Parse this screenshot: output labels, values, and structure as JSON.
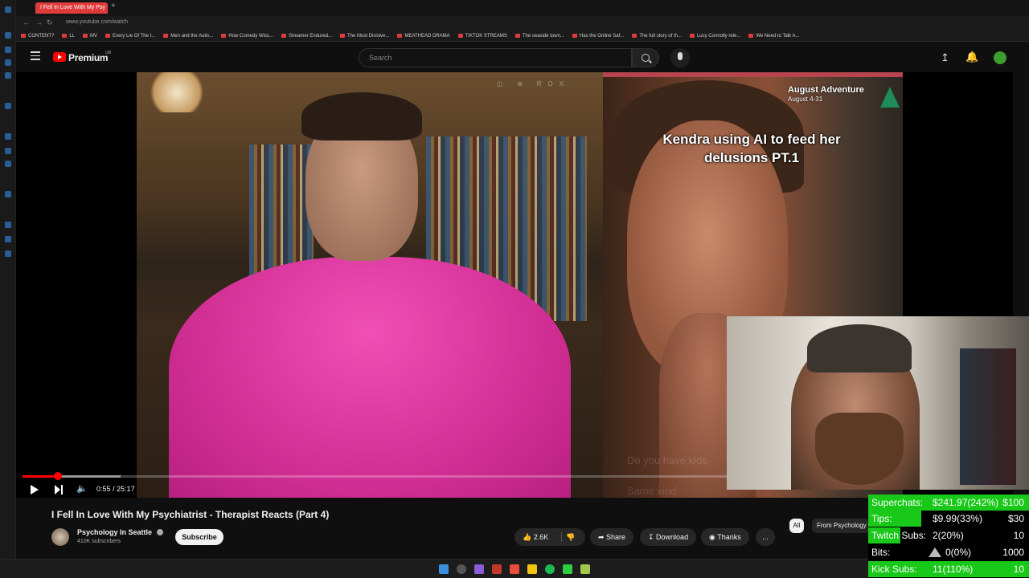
{
  "browser": {
    "active_tab": "I Fell In Love With My Psy",
    "url": "www.youtube.com/watch",
    "bookmarks": [
      "CONTENT?",
      "LL",
      "MV",
      "Every Lie Of The I...",
      "Men and the Autis...",
      "How Comedy Wiss...",
      "Streamer Endured...",
      "The Most Divisive...",
      "MEATHEAD DRAMA",
      "TIKTOK STREAMS",
      "The seaside town...",
      "Has the Online Saf...",
      "The full story of th...",
      "Lucy Connolly rele...",
      "We Need to Talk A..."
    ]
  },
  "youtube": {
    "brand": "Premium",
    "region": "GB",
    "search_placeholder": "Search"
  },
  "video": {
    "tiktok_caption": "Kendra using AI to feed her delusions PT.1",
    "tiktok_tag_title": "August Adventure",
    "tiktok_tag_dates": "August 4-31",
    "faded_sub_1": "Do you have kids",
    "faded_sub_2": "Same kind",
    "overlay_icons_label": "ROX",
    "time_current": "0:55",
    "time_total": "25:17",
    "progress_fraction": 0.036,
    "buffer_fraction": 0.1
  },
  "meta": {
    "title": "I Fell In Love With My Psychiatrist - Therapist Reacts (Part 4)",
    "channel": "Psychology In Seattle",
    "subscribers": "410K subscribers",
    "subscribe_label": "Subscribe",
    "likes": "2.6K",
    "share_label": "Share",
    "download_label": "Download",
    "thanks_label": "Thanks",
    "more_label": "...",
    "chip_all": "All",
    "chip_from": "From Psychology"
  },
  "stats": [
    {
      "key": "Superchats:",
      "value": "$241.97(242%)",
      "goal": "$100",
      "fill": 1.0,
      "color": "#19c919"
    },
    {
      "key": "Tips:",
      "value": "$9.99(33%)",
      "goal": "$30",
      "fill": 0.33,
      "color": "#19c919"
    },
    {
      "key": "Twitch Subs:",
      "value": "2(20%)",
      "goal": "10",
      "fill": 0.2,
      "color": "#19c919"
    },
    {
      "key": "Bits:",
      "value": "0(0%)",
      "goal": "1000",
      "fill": 0.0,
      "color": "#19c919"
    },
    {
      "key": "Kick Subs:",
      "value": "11(110%)",
      "goal": "10",
      "fill": 1.0,
      "color": "#19c919"
    }
  ]
}
